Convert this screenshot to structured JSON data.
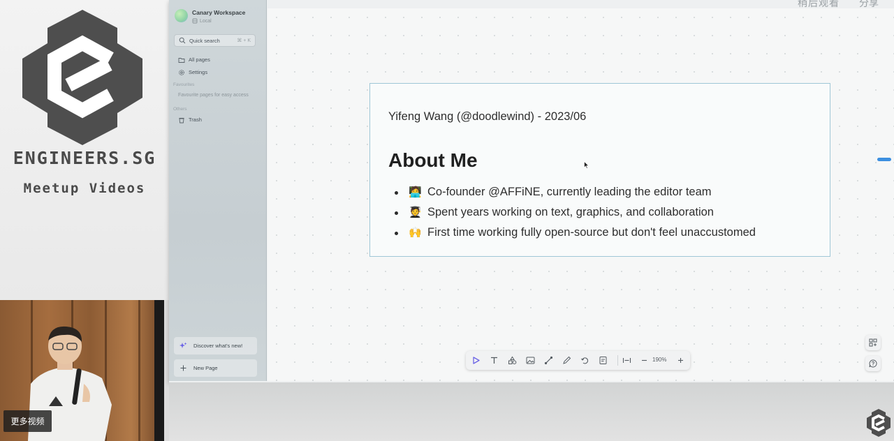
{
  "brand": {
    "name": "ENGINEERS.SG",
    "subtitle": "Meetup Videos"
  },
  "video_overlay": {
    "more_videos_label": "更多视频",
    "top_right_label_1": "稍后观看",
    "top_right_label_2": "分享"
  },
  "sidebar": {
    "workspace_name": "Canary Workspace",
    "workspace_type": "Local",
    "quick_search": {
      "label": "Quick search",
      "shortcut": "⌘ + K"
    },
    "nav": [
      {
        "label": "All pages",
        "icon": "folder-icon"
      },
      {
        "label": "Settings",
        "icon": "gear-icon"
      }
    ],
    "favourites_heading": "Favourites",
    "favourites_hint": "Favourite pages for easy access",
    "others_heading": "Others",
    "trash_label": "Trash",
    "discover_label": "Discover what's new!",
    "new_page_label": "New Page"
  },
  "note": {
    "meta": "Yifeng Wang (@doodlewind) - 2023/06",
    "heading": "About Me",
    "bullets": [
      {
        "emoji": "🧑‍💻",
        "text": "Co-founder @AFFiNE, currently leading the editor team"
      },
      {
        "emoji": "🧑‍🎓",
        "text": "Spent years working on text, graphics, and collaboration"
      },
      {
        "emoji": "🙌",
        "text": "First time working fully open-source but don't feel unaccustomed"
      }
    ]
  },
  "toolbar": {
    "zoom": "190%",
    "tools": [
      "select-icon",
      "text-icon",
      "shape-icon",
      "image-icon",
      "connector-icon",
      "pen-icon",
      "eraser-icon",
      "note-icon",
      "fit-icon",
      "zoom-out-icon",
      "zoom-in-icon"
    ]
  },
  "colors": {
    "note_border": "#9fc7d7",
    "accent_blue": "#3c8fe0",
    "brand_gray": "#4a4a4a",
    "select_tool": "#6b63e6"
  }
}
